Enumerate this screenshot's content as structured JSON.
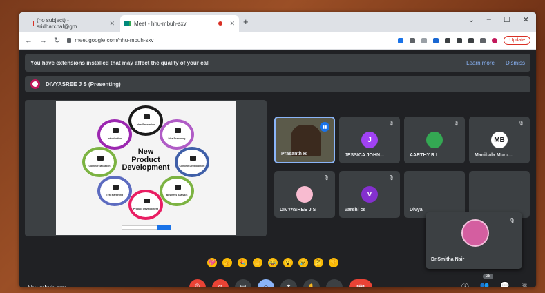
{
  "browser": {
    "tabs": [
      {
        "title": "(no subject) - sridharchal@gm...",
        "icon": "gmail-icon"
      },
      {
        "title": "Meet - hhu-mbuh-sxv",
        "icon": "meet-icon"
      }
    ],
    "url": "meet.google.com/hhu-mbuh-sxv",
    "update_label": "Update"
  },
  "banner": {
    "message": "You have extensions installed that may affect the quality of your call",
    "learn_more": "Learn more",
    "dismiss": "Dismiss"
  },
  "presenter": {
    "label": "DIVYASREE J S (Presenting)"
  },
  "slide": {
    "center_line1": "New",
    "center_line2": "Product",
    "center_line3": "Development",
    "petals": [
      "Idea Generation",
      "Idea Screening",
      "Concept Development",
      "Business Analysis",
      "Product Development",
      "Test Marketing",
      "Commercialization",
      "Introduction"
    ]
  },
  "participants": [
    {
      "name": "Prasanth R",
      "initial": "",
      "color": "#3b2a1e",
      "speaking": true
    },
    {
      "name": "JESSICA JOHN...",
      "initial": "J",
      "color": "#a142f4"
    },
    {
      "name": "AARTHY R L",
      "initial": "",
      "color": "#34a853"
    },
    {
      "name": "Manibala Muru...",
      "initial": "MB",
      "color": "#ffffff"
    },
    {
      "name": "DIVYASREE J S",
      "initial": "",
      "color": "#f8bbd0"
    },
    {
      "name": "varshi cs",
      "initial": "V",
      "color": "#8430ce"
    },
    {
      "name": "Divya",
      "initial": "",
      "color": "#3c4043"
    }
  ],
  "floating": {
    "name": "Dr.Smitha Nair"
  },
  "reactions": [
    "💖",
    "👍",
    "🎉",
    "👏",
    "😂",
    "😮",
    "😢",
    "🤔",
    "👎"
  ],
  "meeting_code": "hhu-mbuh-sxv",
  "participant_count": "28",
  "colors": {
    "accent": "#8ab4f8",
    "end_call": "#ea4335",
    "background": "#202124"
  }
}
